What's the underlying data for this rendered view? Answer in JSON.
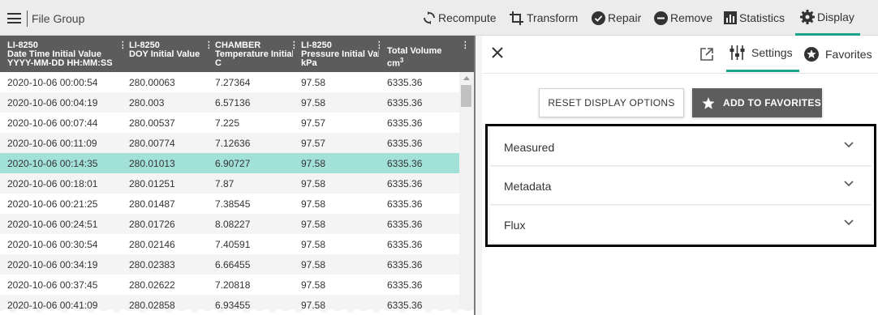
{
  "app": {
    "brand": "File Group"
  },
  "toolbar": {
    "recompute": "Recompute",
    "transform": "Transform",
    "repair": "Repair",
    "remove": "Remove",
    "statistics": "Statistics",
    "display": "Display",
    "active": "Display"
  },
  "table": {
    "columns": [
      {
        "line1": "LI-8250",
        "line2": "Date Time Initial Value",
        "line3": "YYYY-MM-DD HH:MM:SS"
      },
      {
        "line1": "LI-8250",
        "line2": "DOY Initial Value",
        "line3": ""
      },
      {
        "line1": "CHAMBER",
        "line2": "Temperature Initial Value",
        "line3": "C"
      },
      {
        "line1": "LI-8250",
        "line2": "Pressure Initial Value",
        "line3": "kPa"
      },
      {
        "line1": "",
        "line2": "Total Volume",
        "line3": "cm",
        "unit_sup": "3"
      }
    ],
    "rows": [
      [
        "2020-10-06 00:00:54",
        "280.00063",
        "7.27364",
        "97.58",
        "6335.36"
      ],
      [
        "2020-10-06 00:04:19",
        "280.003",
        "6.57136",
        "97.58",
        "6335.36"
      ],
      [
        "2020-10-06 00:07:44",
        "280.00537",
        "7.225",
        "97.57",
        "6335.36"
      ],
      [
        "2020-10-06 00:11:09",
        "280.00774",
        "7.12636",
        "97.57",
        "6335.36"
      ],
      [
        "2020-10-06 00:14:35",
        "280.01013",
        "6.90727",
        "97.58",
        "6335.36"
      ],
      [
        "2020-10-06 00:18:01",
        "280.01251",
        "7.87",
        "97.58",
        "6335.36"
      ],
      [
        "2020-10-06 00:21:25",
        "280.01487",
        "7.38545",
        "97.58",
        "6335.36"
      ],
      [
        "2020-10-06 00:24:51",
        "280.01726",
        "8.08227",
        "97.58",
        "6335.36"
      ],
      [
        "2020-10-06 00:30:54",
        "280.02146",
        "7.40591",
        "97.58",
        "6335.36"
      ],
      [
        "2020-10-06 00:34:19",
        "280.02383",
        "6.66455",
        "97.58",
        "6335.36"
      ],
      [
        "2020-10-06 00:37:45",
        "280.02622",
        "7.20818",
        "97.58",
        "6335.36"
      ],
      [
        "2020-10-06 00:41:09",
        "280.02858",
        "6.93455",
        "97.58",
        "6335.36"
      ]
    ],
    "selected_row": 4
  },
  "panel": {
    "tabs": {
      "settings": "Settings",
      "favorites": "Favorites",
      "active": "Settings"
    },
    "reset_button": "RESET DISPLAY OPTIONS",
    "favorites_button": "ADD TO FAVORITES",
    "sections": [
      "Measured",
      "Metadata",
      "Flux"
    ]
  },
  "colors": {
    "accent": "#1aa58a",
    "header_bg": "#5c5c5c",
    "selected_row": "#a2e1d7",
    "toolbar_bg": "#ececec"
  },
  "icons": {
    "menu": "hamburger-icon",
    "recompute": "recompute-icon",
    "transform": "crop-icon",
    "repair": "check-circle-icon",
    "remove": "minus-circle-icon",
    "statistics": "bar-chart-icon",
    "display": "gear-icon",
    "close": "close-icon",
    "popout": "open-external-icon",
    "settings": "sliders-icon",
    "favorites": "star-circle-icon",
    "expand": "chevron-down-icon"
  }
}
